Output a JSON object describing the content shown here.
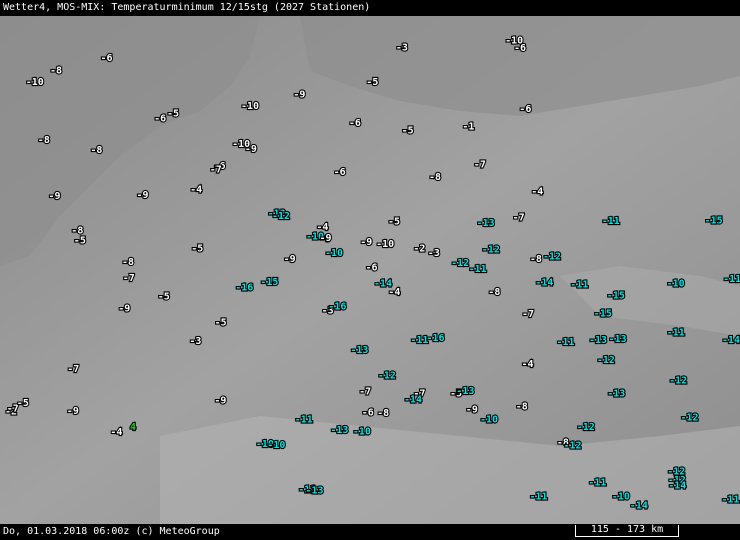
{
  "title": "Wetter4, MOS-MIX: Temperaturminimum 12/15stg (2027 Stationen)",
  "footer": {
    "timestamp": "Do, 01.03.2018 06:00z (c) MeteoGroup",
    "scale": "115 - 173 km"
  },
  "colors": {
    "background": "#9a9a9a",
    "text_warm": "#ffffff",
    "text_cold": "#00e5e5",
    "text_special": "#22cc22",
    "bars": "#000000"
  },
  "stations": [
    {
      "label": "-2",
      "c": "w"
    },
    {
      "label": "-5",
      "c": "w"
    },
    {
      "label": "-2",
      "c": "w"
    },
    {
      "label": "-3",
      "c": "w"
    },
    {
      "label": "-3",
      "c": "w"
    },
    {
      "label": "-4",
      "c": "w"
    },
    {
      "label": "-1",
      "c": "w"
    },
    {
      "label": "-5",
      "c": "w"
    },
    {
      "label": "-3",
      "c": "w"
    },
    {
      "label": "-5",
      "c": "w"
    },
    {
      "label": "-4",
      "c": "w"
    },
    {
      "label": "-5",
      "c": "w"
    },
    {
      "label": "-7",
      "c": "w"
    },
    {
      "label": "-6",
      "c": "w"
    },
    {
      "label": "-8",
      "c": "w"
    },
    {
      "label": "-6",
      "c": "w"
    },
    {
      "label": "-7",
      "c": "w"
    },
    {
      "label": "-8",
      "c": "w"
    },
    {
      "label": "-9",
      "c": "w"
    },
    {
      "label": "-8",
      "c": "w"
    },
    {
      "label": "-7",
      "c": "w"
    },
    {
      "label": "-8",
      "c": "w"
    },
    {
      "label": "-9",
      "c": "w"
    },
    {
      "label": "-10",
      "c": "w"
    },
    {
      "label": "-6",
      "c": "w"
    },
    {
      "label": "-7",
      "c": "w"
    },
    {
      "label": "-8",
      "c": "w"
    },
    {
      "label": "-9",
      "c": "w"
    },
    {
      "label": "-10",
      "c": "w"
    },
    {
      "label": "-11",
      "c": "c"
    },
    {
      "label": "-5",
      "c": "w"
    },
    {
      "label": "-6",
      "c": "w"
    },
    {
      "label": "-7",
      "c": "w"
    },
    {
      "label": "-8",
      "c": "w"
    },
    {
      "label": "-9",
      "c": "w"
    },
    {
      "label": "-10",
      "c": "c"
    },
    {
      "label": "-4",
      "c": "w"
    },
    {
      "label": "-5",
      "c": "w"
    },
    {
      "label": "-6",
      "c": "w"
    },
    {
      "label": "-4",
      "c": "w"
    },
    {
      "label": "-5",
      "c": "w"
    },
    {
      "label": "-7",
      "c": "w"
    },
    {
      "label": "-9",
      "c": "w"
    },
    {
      "label": "-10",
      "c": "c"
    },
    {
      "label": "-11",
      "c": "c"
    },
    {
      "label": "-12",
      "c": "c"
    },
    {
      "label": "-13",
      "c": "c"
    },
    {
      "label": "-11",
      "c": "c"
    },
    {
      "label": "-12",
      "c": "c"
    },
    {
      "label": "-14",
      "c": "c"
    },
    {
      "label": "-15",
      "c": "c"
    },
    {
      "label": "-16",
      "c": "c"
    },
    {
      "label": "-13",
      "c": "c"
    },
    {
      "label": "-14",
      "c": "c"
    },
    {
      "label": "-12",
      "c": "c"
    },
    {
      "label": "-11",
      "c": "c"
    },
    {
      "label": "-10",
      "c": "c"
    },
    {
      "label": "-9",
      "c": "w"
    },
    {
      "label": "-8",
      "c": "w"
    },
    {
      "label": "-7",
      "c": "w"
    },
    {
      "label": "-6",
      "c": "w"
    },
    {
      "label": "-5",
      "c": "w"
    },
    {
      "label": "-4",
      "c": "w"
    },
    {
      "label": "-3",
      "c": "w"
    },
    {
      "label": "4",
      "c": "g"
    },
    {
      "label": "-6",
      "c": "w"
    },
    {
      "label": "-8",
      "c": "w"
    },
    {
      "label": "-10",
      "c": "c"
    },
    {
      "label": "-12",
      "c": "c"
    },
    {
      "label": "-13",
      "c": "c"
    },
    {
      "label": "-9",
      "c": "w"
    },
    {
      "label": "-11",
      "c": "c"
    },
    {
      "label": "-10",
      "c": "w"
    },
    {
      "label": "-12",
      "c": "c"
    },
    {
      "label": "-11",
      "c": "c"
    },
    {
      "label": "-13",
      "c": "c"
    },
    {
      "label": "-10",
      "c": "c"
    },
    {
      "label": "-11",
      "c": "c"
    },
    {
      "label": "-9",
      "c": "w"
    },
    {
      "label": "-12",
      "c": "c"
    },
    {
      "label": "-14",
      "c": "c"
    },
    {
      "label": "-15",
      "c": "c"
    },
    {
      "label": "-13",
      "c": "c"
    },
    {
      "label": "-16",
      "c": "c"
    },
    {
      "label": "-8",
      "c": "w"
    },
    {
      "label": "-7",
      "c": "w"
    },
    {
      "label": "-6",
      "c": "w"
    },
    {
      "label": "-5",
      "c": "w"
    },
    {
      "label": "-9",
      "c": "w"
    },
    {
      "label": "-10",
      "c": "c"
    },
    {
      "label": "-11",
      "c": "c"
    },
    {
      "label": "-12",
      "c": "c"
    },
    {
      "label": "-10",
      "c": "w"
    },
    {
      "label": "-9",
      "c": "w"
    },
    {
      "label": "-8",
      "c": "w"
    },
    {
      "label": "-11",
      "c": "c"
    },
    {
      "label": "-12",
      "c": "c"
    },
    {
      "label": "-13",
      "c": "c"
    },
    {
      "label": "-14",
      "c": "c"
    },
    {
      "label": "-11",
      "c": "c"
    },
    {
      "label": "-10",
      "c": "c"
    },
    {
      "label": "-9",
      "c": "w"
    },
    {
      "label": "-12",
      "c": "c"
    },
    {
      "label": "-15",
      "c": "c"
    },
    {
      "label": "-13",
      "c": "c"
    },
    {
      "label": "-11",
      "c": "c"
    },
    {
      "label": "-10",
      "c": "w"
    },
    {
      "label": "-8",
      "c": "w"
    },
    {
      "label": "-12",
      "c": "c"
    },
    {
      "label": "-11",
      "c": "c"
    },
    {
      "label": "-10",
      "c": "c"
    },
    {
      "label": "-9",
      "c": "w"
    },
    {
      "label": "-13",
      "c": "c"
    },
    {
      "label": "-14",
      "c": "c"
    },
    {
      "label": "-12",
      "c": "c"
    },
    {
      "label": "-16",
      "c": "c"
    },
    {
      "label": "-15",
      "c": "c"
    },
    {
      "label": "-14",
      "c": "c"
    },
    {
      "label": "-13",
      "c": "c"
    },
    {
      "label": "-12",
      "c": "c"
    },
    {
      "label": "-7",
      "c": "w"
    },
    {
      "label": "-6",
      "c": "w"
    },
    {
      "label": "-5",
      "c": "w"
    },
    {
      "label": "-4",
      "c": "w"
    }
  ]
}
